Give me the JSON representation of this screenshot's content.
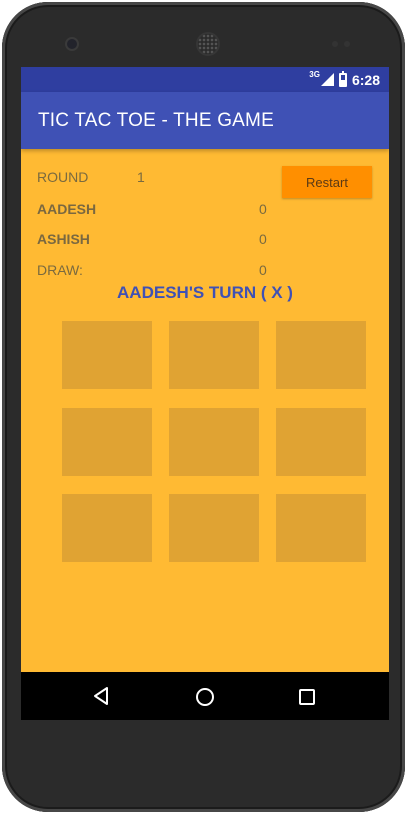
{
  "status_bar": {
    "network": "3G",
    "time": "6:28",
    "icons": [
      "signal-icon",
      "battery-icon"
    ]
  },
  "app_bar": {
    "title": "TIC TAC TOE - THE GAME"
  },
  "scores": {
    "round_label": "ROUND",
    "round_value": "1",
    "player1_name": "AADESH",
    "player1_score": "0",
    "player2_name": "ASHISH",
    "player2_score": "0",
    "draw_label": "DRAW:",
    "draw_value": "0"
  },
  "restart_label": "Restart",
  "turn_text": "AADESH'S TURN ( X )",
  "board": [
    "",
    "",
    "",
    "",
    "",
    "",
    "",
    "",
    ""
  ],
  "nav_bar": {
    "icons": [
      "back-icon",
      "home-icon",
      "recent-apps-icon"
    ]
  },
  "colors": {
    "status_bar": "#2F3EA0",
    "app_bar": "#3F51B5",
    "background": "#FFBA33",
    "cell": "#E0A333",
    "button": "#FF8F00",
    "turn_text": "#3F51B5"
  }
}
